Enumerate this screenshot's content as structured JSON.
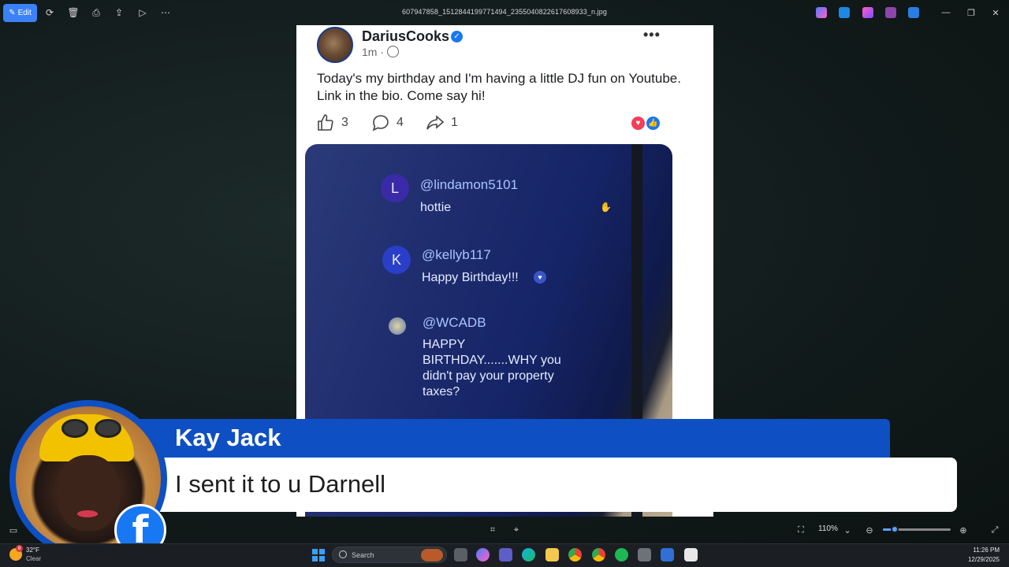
{
  "window": {
    "filename": "607947858_1512844199771494_2355040822617608933_n.jpg",
    "edit_label": "Edit"
  },
  "post": {
    "author": "DariusCooks",
    "time": "1m ·",
    "text": "Today's my birthday and I'm having a little DJ fun on Youtube. Link in the bio. Come say hi!",
    "likes": "3",
    "comments": "4",
    "shares": "1",
    "more": "•••"
  },
  "chat": [
    {
      "initial": "L",
      "user": "@lindamon5101",
      "message": "hottie",
      "avatar_color": "#3b2aa8"
    },
    {
      "initial": "K",
      "user": "@kellyb117",
      "message": "Happy Birthday!!!",
      "avatar_color": "#2a3fc8"
    },
    {
      "initial": "",
      "user": "@WCADB",
      "message": "HAPPY BIRTHDAY.......WHY you didn't pay your property taxes?",
      "avatar_color": "#6b7aa8"
    }
  ],
  "lower_third": {
    "name": "Kay Jack",
    "message": "I sent it to u Darnell",
    "badge": "f"
  },
  "statusbar": {
    "zoom": "110%",
    "zoom_fraction": 0.18
  },
  "taskbar": {
    "temperature": "32°F",
    "condition": "Clear",
    "weather_badge": "8",
    "search_placeholder": "Search",
    "time": "11:26 PM",
    "date": "12/29/2025"
  },
  "colors": {
    "accent": "#3b82f6",
    "lower_third_blue": "#0f4fc4",
    "facebook_blue": "#1877f2"
  }
}
